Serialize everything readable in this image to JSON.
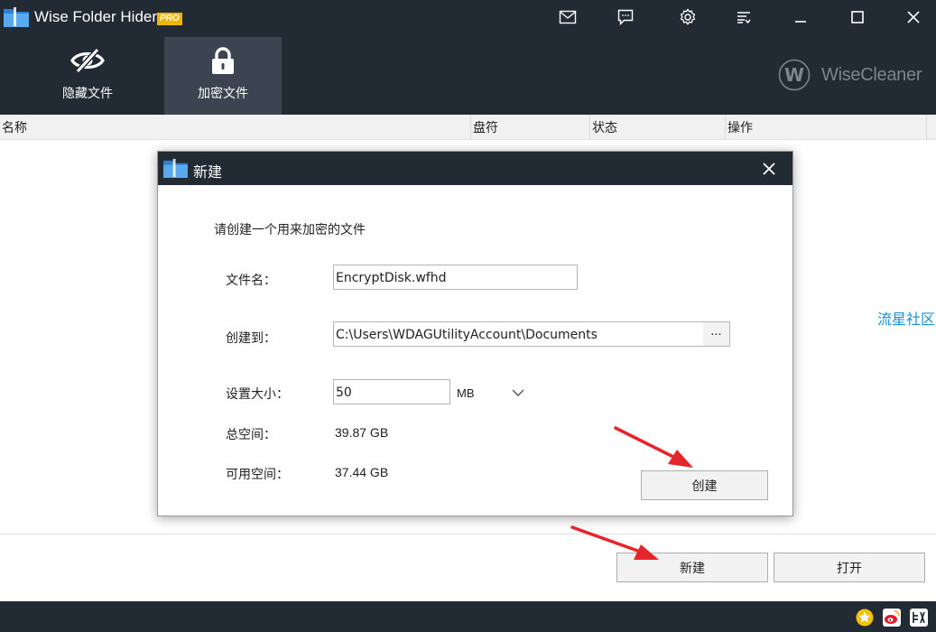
{
  "app": {
    "title": "Wise Folder Hider",
    "badge": "PRO",
    "brand": "WiseCleaner"
  },
  "tabs": [
    {
      "label": "隐藏文件",
      "icon": "eye-slash-icon",
      "active": false
    },
    {
      "label": "加密文件",
      "icon": "lock-icon",
      "active": true
    }
  ],
  "table": {
    "columns": [
      "名称",
      "盘符",
      "状态",
      "操作"
    ]
  },
  "side_link": "流星社区",
  "buttons": {
    "new": "新建",
    "open": "打开"
  },
  "dialog": {
    "title": "新建",
    "instruction": "请创建一个用来加密的文件",
    "filename_label": "文件名：",
    "filename_value": "EncryptDisk.wfhd",
    "location_label": "创建到：",
    "location_value": "C:\\Users\\WDAGUtilityAccount\\Documents",
    "browse_label": "...",
    "size_label": "设置大小：",
    "size_value": "50",
    "size_unit": "MB",
    "total_label": "总空间：",
    "total_value": "39.87 GB",
    "free_label": "可用空间：",
    "free_value": "37.44 GB",
    "create_button": "创建"
  },
  "colors": {
    "header_bg": "#222a33",
    "active_tab_bg": "#3b4450",
    "badge": "#f0b400",
    "link": "#1a8fd8",
    "arrow": "#e5252a"
  }
}
